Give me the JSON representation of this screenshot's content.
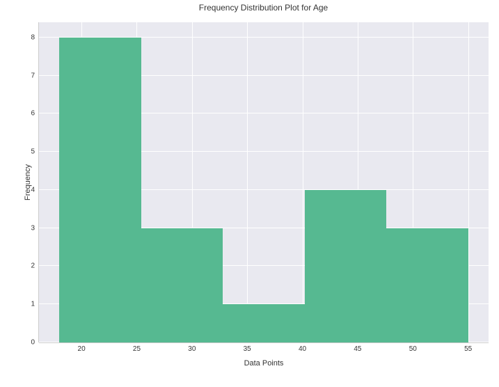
{
  "chart_data": {
    "type": "bar",
    "title": "Frequency Distribution Plot for Age",
    "xlabel": "Data Points",
    "ylabel": "Frequency",
    "bin_edges": [
      18,
      25.4,
      32.8,
      40.2,
      47.6,
      55
    ],
    "values": [
      8,
      3,
      1,
      4,
      3
    ],
    "xlim": [
      16.15,
      56.85
    ],
    "ylim": [
      0,
      8.4
    ],
    "xticks": [
      20,
      25,
      30,
      35,
      40,
      45,
      50,
      55
    ],
    "yticks": [
      0,
      1,
      2,
      3,
      4,
      5,
      6,
      7,
      8
    ]
  }
}
